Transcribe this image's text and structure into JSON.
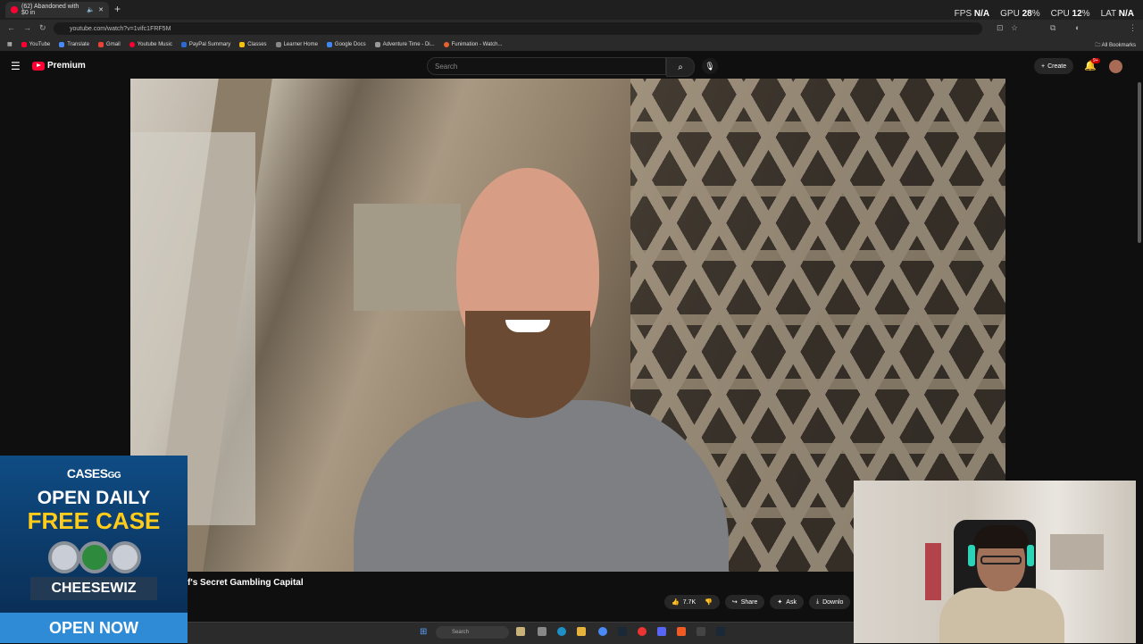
{
  "browser": {
    "tab_title": "(62) Abandoned with $0 in",
    "new_tab": "+",
    "url": "youtube.com/watch?v=1vifc1FRF5M",
    "all_bookmarks": "All Bookmarks",
    "bookmarks": [
      "YouTube",
      "Translate",
      "Gmail",
      "Youtube Music",
      "PayPal Summary",
      "Classes",
      "Learner Home",
      "Google Docs",
      "Adventure Time - Di...",
      "Funimation - Watch..."
    ]
  },
  "overlay_stats": {
    "fps_label": "FPS",
    "fps_value": "N/A",
    "gpu_label": "GPU",
    "gpu_value": "28",
    "gpu_unit": "%",
    "cpu_label": "CPU",
    "cpu_value": "12",
    "cpu_unit": "%",
    "lat_label": "LAT",
    "lat_value": "N/A"
  },
  "youtube": {
    "logo_text": "Premium",
    "search_placeholder": "Search",
    "create_label": "Create",
    "notif_badge": "9+",
    "video_title": "f's Secret Gambling Capital",
    "like_count": "7.7K",
    "share_label": "Share",
    "ask_label": "Ask",
    "download_label": "Downlo"
  },
  "taskbar": {
    "search_placeholder": "Search"
  },
  "ad": {
    "brand": "CASES",
    "brand_suffix": "GG",
    "line1": "OPEN DAILY",
    "line2": "FREE CASE",
    "code": "CHEESEWIZ",
    "button": "OPEN NOW"
  },
  "colors": {
    "youtube_red": "#ff0033",
    "ad_yellow": "#ffcc1a",
    "ad_blue": "#2f8bd6"
  }
}
